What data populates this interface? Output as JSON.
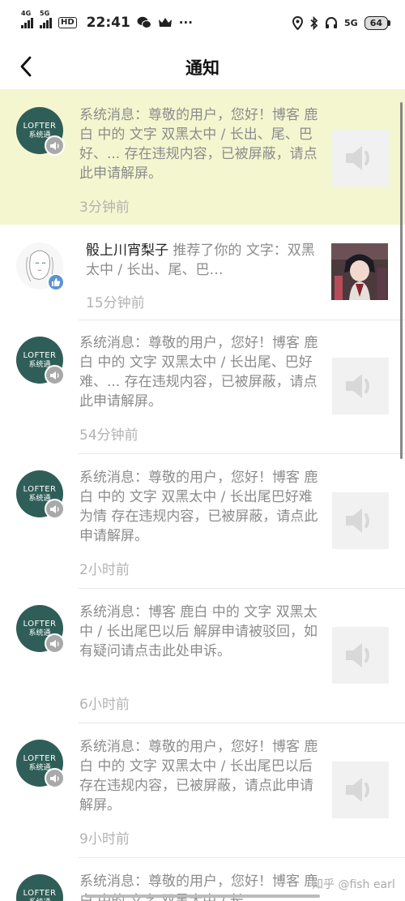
{
  "status_bar": {
    "signal1": "4G",
    "signal2": "5G",
    "hd": "HD",
    "time": "22:41",
    "dots": "···",
    "net": "5G",
    "battery": "64"
  },
  "header": {
    "title": "通知"
  },
  "notifications": [
    {
      "text": "系统消息：尊敬的用户，您好！博客 鹿白 中的 文字 双黑太中 / 长出、尾、巴好、... 存在违规内容，已被屏蔽，请点此申请解屏。",
      "time": "3分钟前"
    },
    {
      "user": "骰上川宵梨子",
      "text": " 推荐了你的 文字：双黑太中 / 长出、尾、巴…",
      "time": "15分钟前"
    },
    {
      "text": "系统消息：尊敬的用户，您好！博客 鹿白 中的 文字 双黑太中 / 长出尾、巴好难、... 存在违规内容，已被屏蔽，请点此申请解屏。",
      "time": "54分钟前"
    },
    {
      "text": "系统消息：尊敬的用户，您好！博客 鹿白 中的 文字 双黑太中 / 长出尾巴好难为情 存在违规内容，已被屏蔽，请点此申请解屏。",
      "time": "2小时前"
    },
    {
      "text": "系统消息：博客 鹿白 中的 文字 双黑太中 / 长出尾巴以后 解屏申请被驳回，如有疑问请点击此处申诉。",
      "time": "6小时前"
    },
    {
      "text": "系统消息：尊敬的用户，您好！博客 鹿白 中的 文字 双黑太中 / 长出尾巴以后 存在违规内容，已被屏蔽，请点此申请解屏。",
      "time": "9小时前"
    },
    {
      "text": "系统消息：尊敬的用户，您好！博客 鹿白 中的 文字 双黑太中 / 长"
    }
  ],
  "avatar": {
    "brand": "LOFTER",
    "label": "系统通"
  },
  "watermark": "知乎 @fish earl",
  "colors": {
    "highlight": "#f4f6cf",
    "lofter_green": "#2f5e58",
    "like_blue": "#5c93d6"
  }
}
